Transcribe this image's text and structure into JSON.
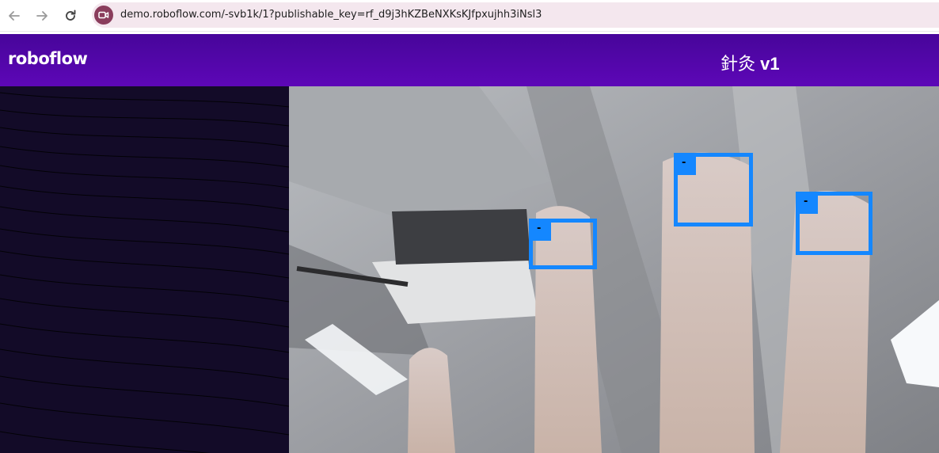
{
  "browser": {
    "back_icon": "arrow-left-icon",
    "forward_icon": "arrow-right-icon",
    "reload_icon": "reload-icon",
    "site_icon": "camera-icon",
    "url": "demo.roboflow.com/-svb1k/1?publishable_key=rf_d9j3hKZBeNXKsKJfpxujhh3iNsl3"
  },
  "header": {
    "brand": "roboflow",
    "model_name": "針灸",
    "model_version": "v1"
  },
  "detections": [
    {
      "label": "-"
    },
    {
      "label": "-"
    },
    {
      "label": "-"
    }
  ],
  "colors": {
    "header_top": "#47059a",
    "header_bottom": "#5d07b7",
    "left_panel": "#130b28",
    "detection_box": "#1487ff"
  }
}
